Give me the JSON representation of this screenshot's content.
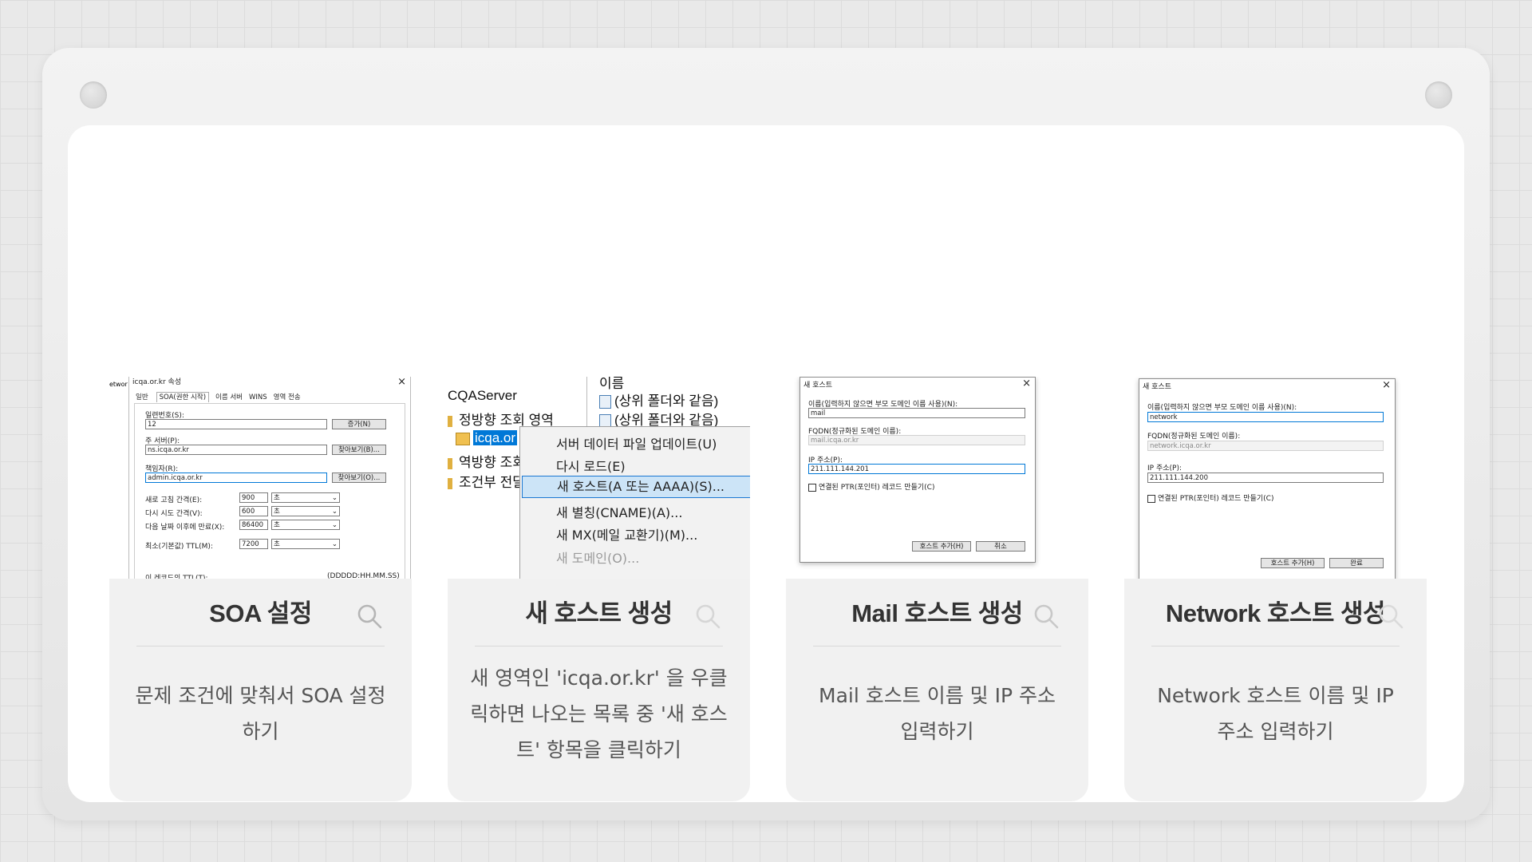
{
  "cards": [
    {
      "title": "SOA 설정",
      "desc": "문제 조건에 맞춰서 SOA 설정하기",
      "soa": {
        "window_title": "icqa.or.kr 속성",
        "side_label": "etwor",
        "tabs": [
          "일반",
          "SOA(권한 시작)",
          "이름 서버",
          "WINS",
          "영역 전송"
        ],
        "serial_label": "일련번호(S):",
        "serial_value": "12",
        "increment_btn": "증가(N)",
        "primary_label": "주 서버(P):",
        "primary_value": "ns.icqa.or.kr",
        "browse_btn1": "찾아보기(B)...",
        "resp_label": "책임자(R):",
        "resp_value": "admin.icqa.or.kr",
        "browse_btn2": "찾아보기(O)...",
        "refresh_label": "새로 고침 간격(E):",
        "refresh_value": "900",
        "retry_label": "다시 시도 간격(V):",
        "retry_value": "600",
        "expire_label": "다음 날짜 이후에 만료(X):",
        "expire_value": "86400",
        "ttl_label": "최소(기본값) TTL(M):",
        "ttl_value": "7200",
        "unit": "초",
        "bottom_label": "이 레코드의 TTL(T):",
        "bottom_fmt": "(DDDDD:HH.MM.SS)"
      }
    },
    {
      "title": "새 호스트 생성",
      "desc": "새 영역인 'icqa.or.kr' 을 우클릭하면 나오는 목록 중 '새 호스트' 항목을 클릭하기",
      "ctx": {
        "tree": [
          "CQAServer",
          "정방향 조회 영역",
          "icqa.or",
          "역방향 조회",
          "조건부 전달"
        ],
        "list_header": "이름",
        "list_items": [
          "(상위 폴더와 같음)",
          "(상위 폴더와 같음)"
        ],
        "menu": [
          "서버 데이터 파일 업데이트(U)",
          "다시 로드(E)",
          "새 호스트(A 또는 AAAA)(S)...",
          "새 별칭(CNAME)(A)...",
          "새 MX(메일 교환기)(M)...",
          "새 도메인(O)..."
        ]
      }
    },
    {
      "title": "Mail 호스트 생성",
      "desc": "Mail 호스트 이름 및 IP 주소 입력하기",
      "host": {
        "window_title": "새 호스트",
        "name_label": "이름(입력하지 않으면 부모 도메인 이름 사용)(N):",
        "name_value": "mail",
        "fqdn_label": "FQDN(정규화된 도메인 이름):",
        "fqdn_value": "mail.icqa.or.kr",
        "ip_label": "IP 주소(P):",
        "ip_value": "211.111.144.201",
        "ptr_label": "연결된 PTR(포인터) 레코드 만들기(C)",
        "add_btn": "호스트 추가(H)",
        "close_btn": "취소"
      }
    },
    {
      "title": "Network 호스트 생성",
      "desc": "Network 호스트 이름 및 IP 주소 입력하기",
      "host": {
        "window_title": "새 호스트",
        "name_label": "이름(입력하지 않으면 부모 도메인 이름 사용)(N):",
        "name_value": "network",
        "fqdn_label": "FQDN(정규화된 도메인 이름):",
        "fqdn_value": "network.icqa.or.kr",
        "ip_label": "IP 주소(P):",
        "ip_value": "211.111.144.200",
        "ptr_label": "연결된 PTR(포인터) 레코드 만들기(C)",
        "add_btn": "호스트 추가(H)",
        "close_btn": "완료"
      }
    }
  ]
}
